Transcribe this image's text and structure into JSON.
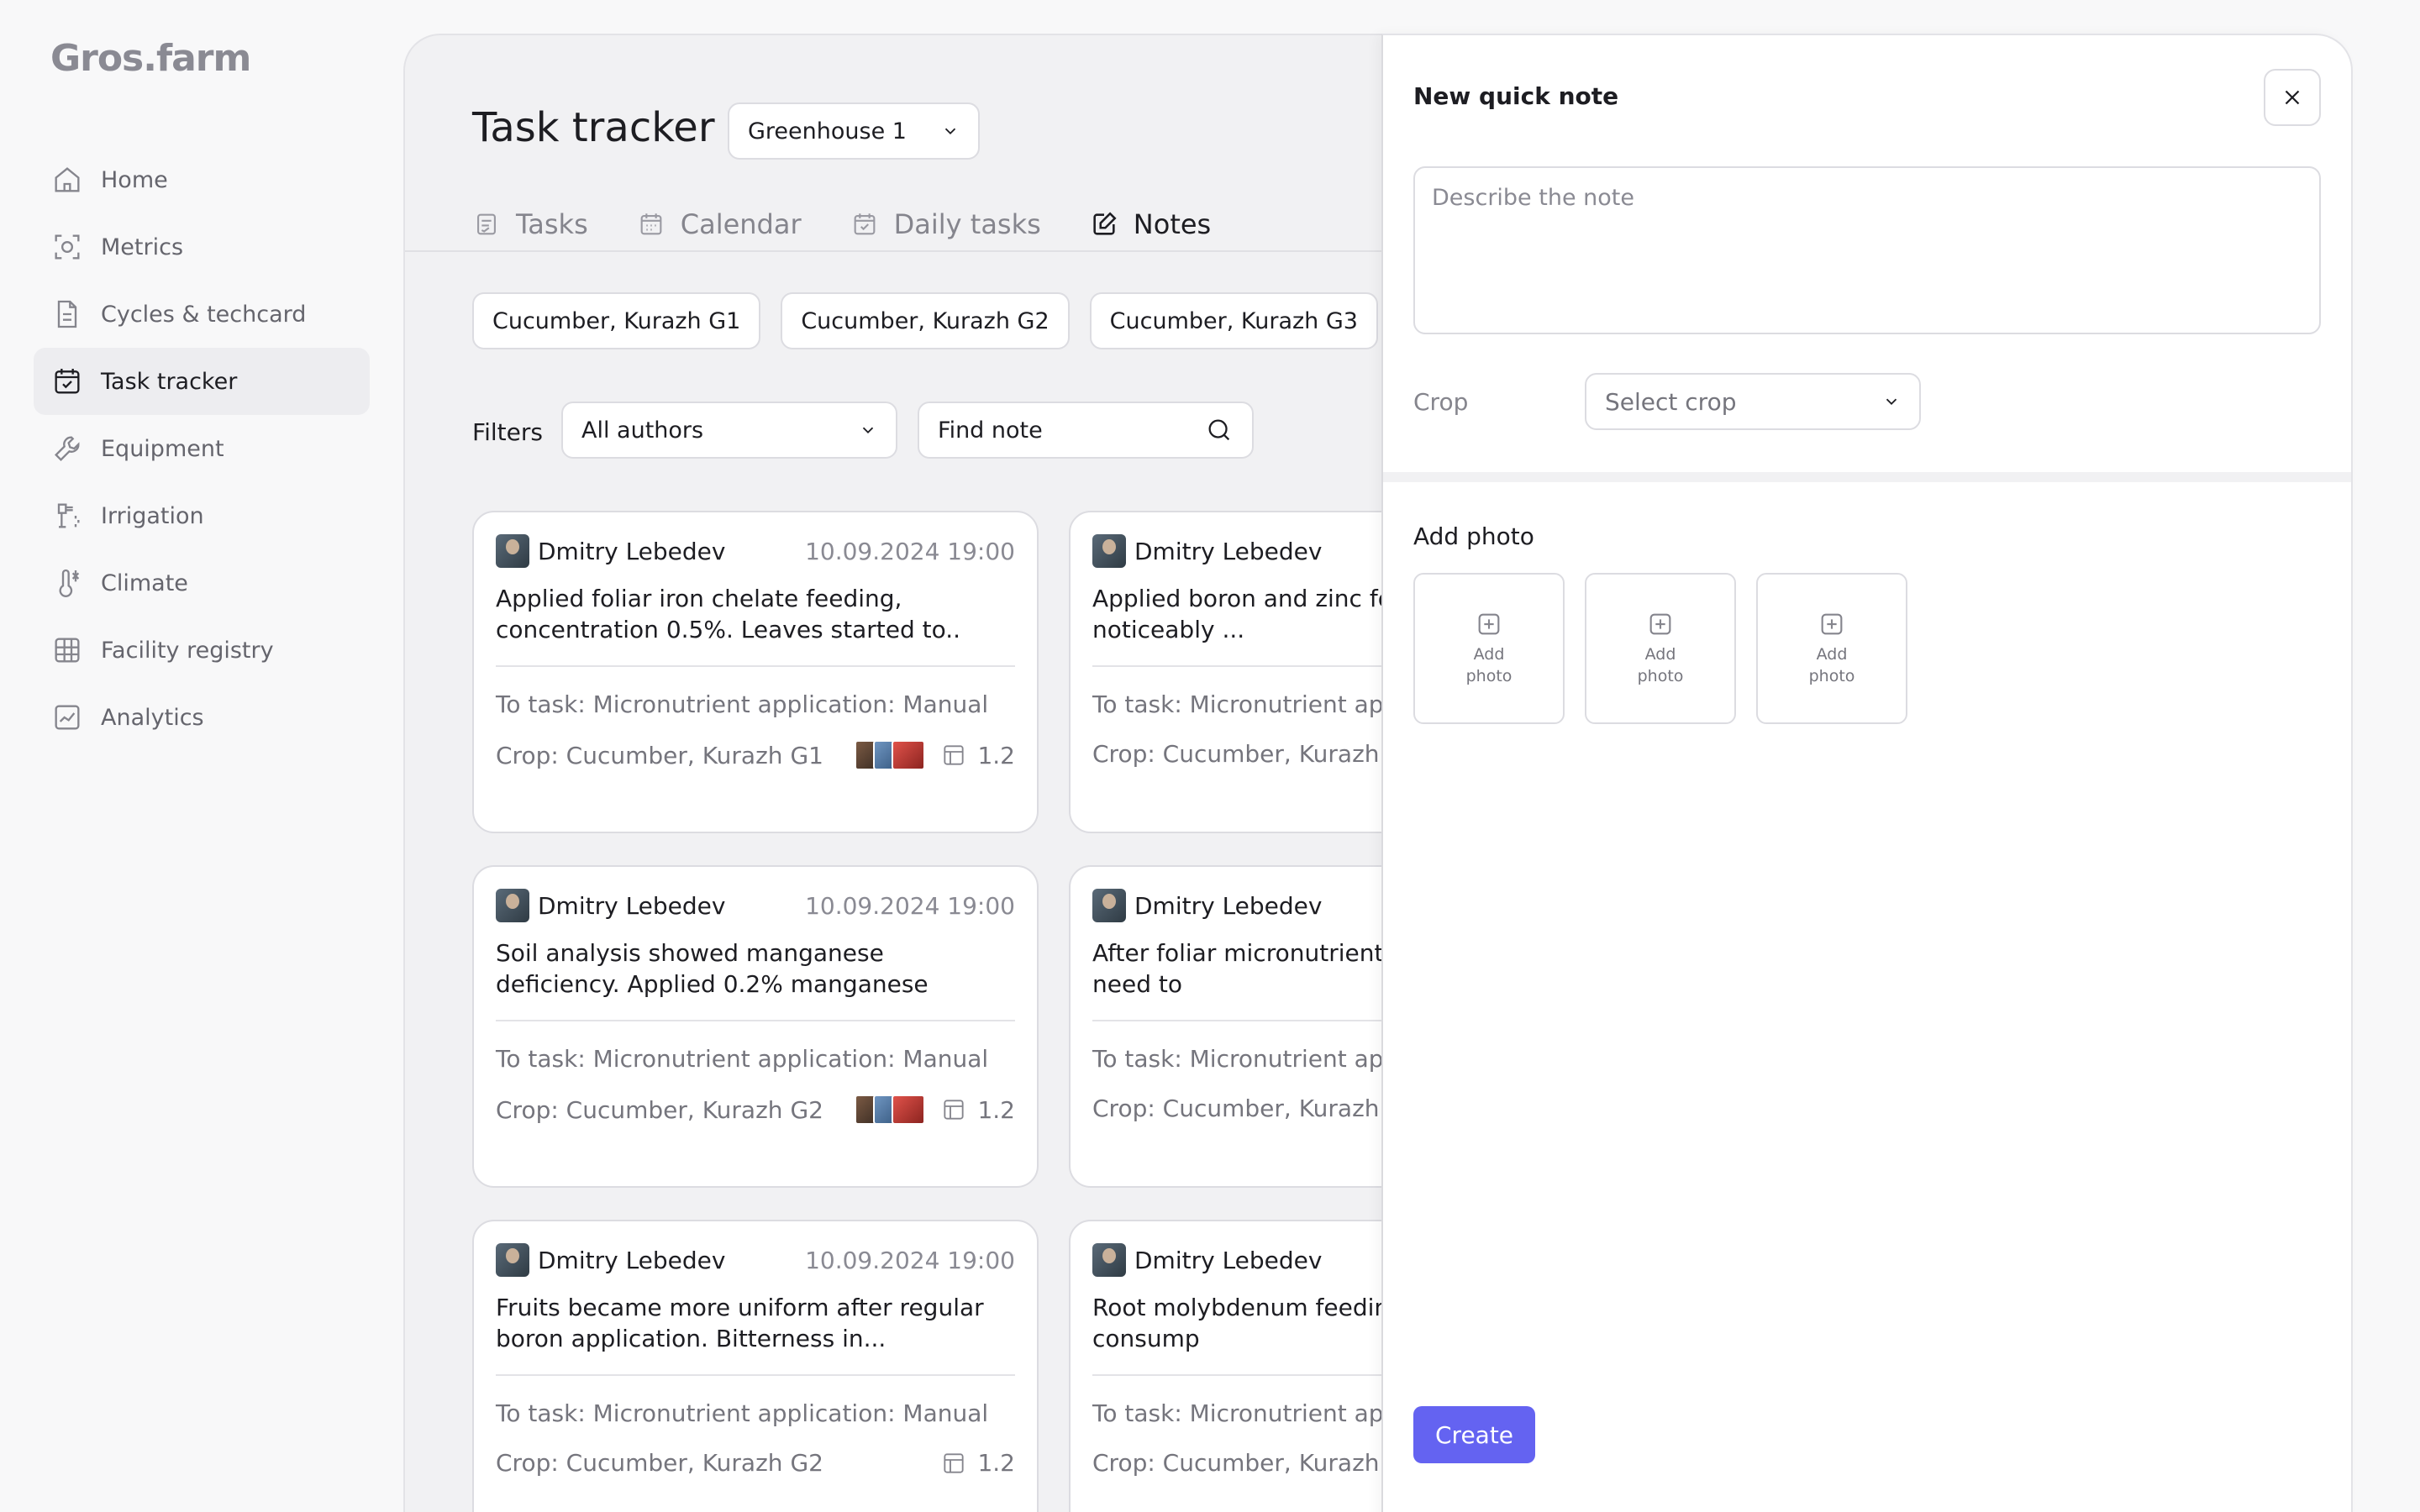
{
  "brand": {
    "logo": "Gros.farm"
  },
  "sidebar": {
    "items": [
      {
        "label": "Home",
        "icon": "home-icon"
      },
      {
        "label": "Metrics",
        "icon": "metrics-icon"
      },
      {
        "label": "Cycles & techcard",
        "icon": "document-icon"
      },
      {
        "label": "Task tracker",
        "icon": "calendar-check-icon",
        "active": true
      },
      {
        "label": "Equipment",
        "icon": "wrench-icon"
      },
      {
        "label": "Irrigation",
        "icon": "irrigation-icon"
      },
      {
        "label": "Climate",
        "icon": "thermometer-icon"
      },
      {
        "label": "Facility registry",
        "icon": "grid-icon"
      },
      {
        "label": "Analytics",
        "icon": "chart-icon"
      }
    ]
  },
  "main": {
    "title": "Task tracker",
    "greenhouse_select": "Greenhouse 1",
    "tabs": [
      {
        "label": "Tasks"
      },
      {
        "label": "Calendar"
      },
      {
        "label": "Daily tasks"
      },
      {
        "label": "Notes",
        "active": true
      }
    ],
    "crop_chips": [
      "Cucumber, Kurazh G1",
      "Cucumber, Kurazh G2",
      "Cucumber, Kurazh G3"
    ],
    "filters_label": "Filters",
    "authors_select": "All authors",
    "find_placeholder": "Find note",
    "notes": [
      {
        "author": "Dmitry Lebedev",
        "date": "10.09.2024 19:00",
        "text": "Applied foliar iron chelate feeding, concentration 0.5%. Leaves started to..",
        "task": "To task: Micronutrient application: Manual",
        "crop": "Crop: Cucumber, Kurazh G1",
        "area": "1.2"
      },
      {
        "author": "Dmitry Lebedev",
        "date": "",
        "text": "Applied boron and zinc fol Fruit set noticeably ...",
        "task": "To task: Micronutrient app",
        "crop": "Crop: Cucumber, Kurazh G",
        "area": ""
      },
      {
        "author": "Dmitry Lebedev",
        "date": "10.09.2024 19:00",
        "text": "Soil analysis showed manganese deficiency. Applied 0.2% manganese sulfate solution...",
        "task": "To task: Micronutrient application: Manual",
        "crop": "Crop: Cucumber, Kurazh G2",
        "area": "1.2"
      },
      {
        "author": "Dmitry Lebedev",
        "date": "",
        "text": "After foliar micronutrient leaf edge burns — need to",
        "task": "To task: Micronutrient app",
        "crop": "Crop: Cucumber, Kurazh G",
        "area": ""
      },
      {
        "author": "Dmitry Lebedev",
        "date": "10.09.2024 19:00",
        "text": "Fruits became more uniform after regular boron application. Bitterness in...",
        "task": "To task: Micronutrient application: Manual",
        "crop": "Crop: Cucumber, Kurazh G2",
        "area": "1.2"
      },
      {
        "author": "Dmitry Lebedev",
        "date": "",
        "text": "Root molybdenum feeding Working solution consump",
        "task": "To task: Micronutrient app",
        "crop": "Crop: Cucumber, Kurazh G",
        "area": ""
      }
    ]
  },
  "panel": {
    "title": "New quick note",
    "note_placeholder": "Describe the note",
    "crop_label": "Crop",
    "crop_placeholder": "Select crop",
    "add_photo_title": "Add photo",
    "photo_slots": [
      "Add photo",
      "Add photo",
      "Add photo"
    ],
    "create_label": "Create"
  },
  "colors": {
    "accent": "#6463f1",
    "background": "#f8f8f9",
    "card": "#ffffff",
    "border": "#dcdce1"
  }
}
